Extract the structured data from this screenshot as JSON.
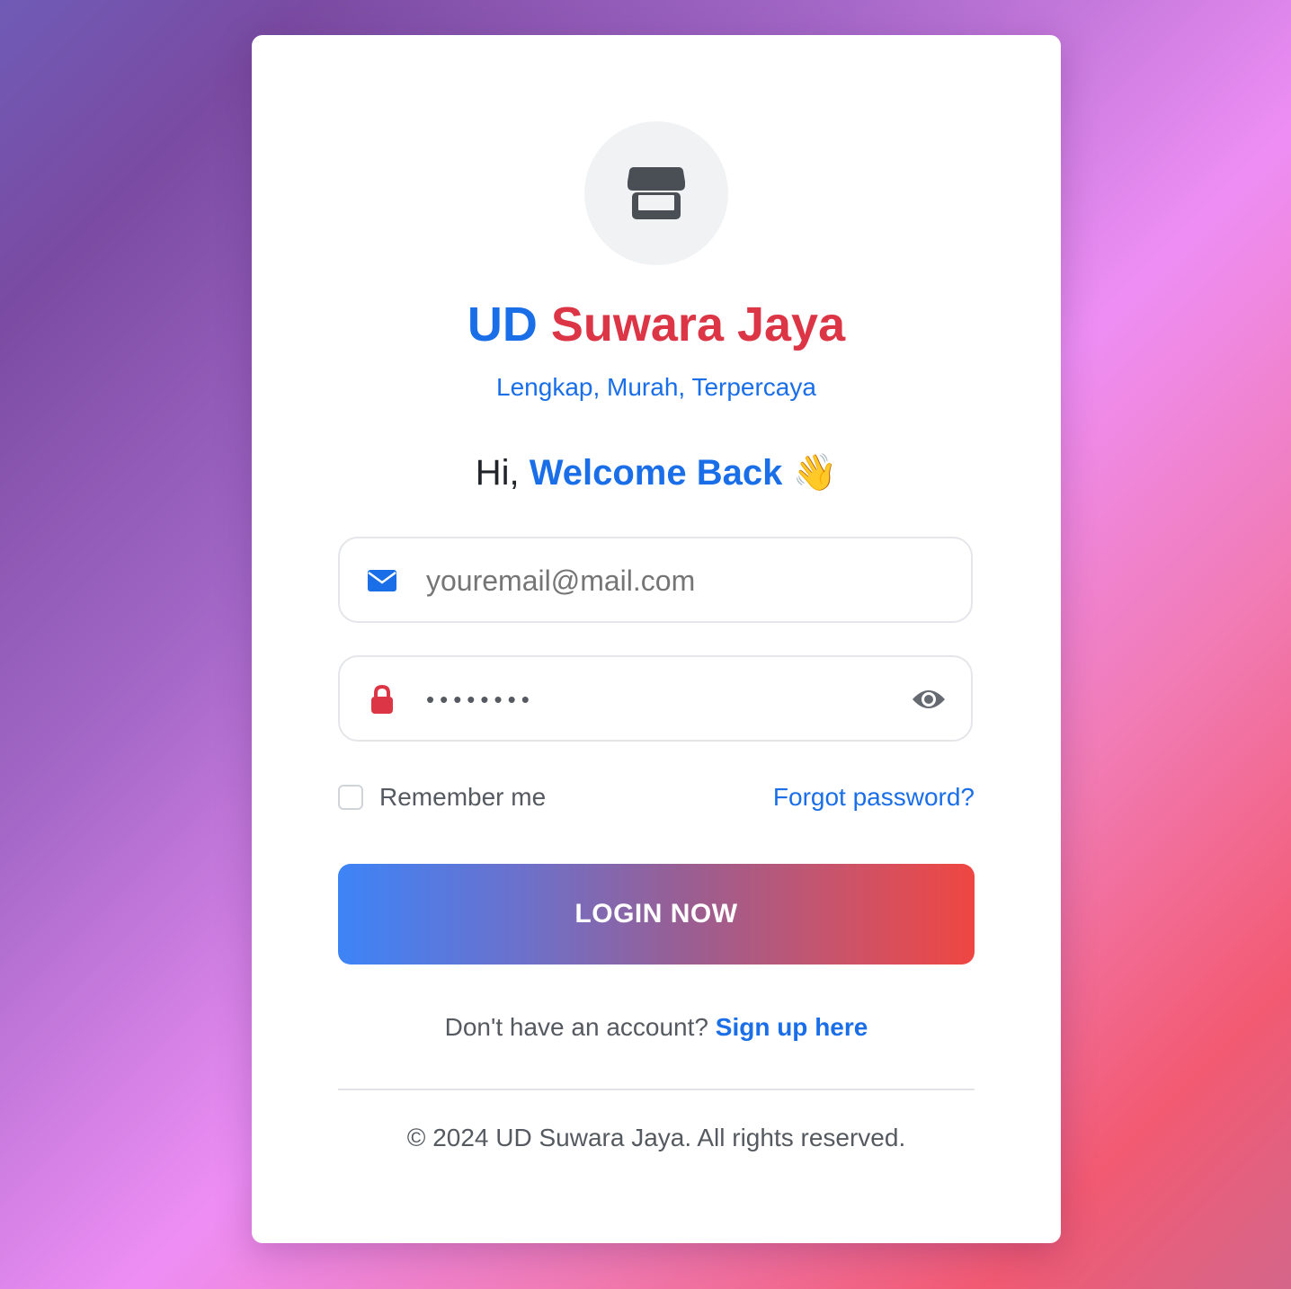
{
  "brand": {
    "prefix": "UD",
    "name": "Suwara Jaya",
    "tagline": "Lengkap, Murah, Terpercaya",
    "logo_icon": "store-icon"
  },
  "welcome": {
    "greeting": "Hi,",
    "highlight": "Welcome Back",
    "emoji": "👋"
  },
  "form": {
    "email": {
      "icon": "envelope-icon",
      "placeholder": "youremail@mail.com",
      "value": ""
    },
    "password": {
      "icon": "lock-icon",
      "value": "••••••••",
      "toggle_icon": "eye-icon"
    },
    "remember_label": "Remember me",
    "remember_checked": false,
    "forgot_label": "Forgot password?",
    "submit_label": "LOGIN NOW"
  },
  "signup": {
    "prompt": "Don't have an account?",
    "link": "Sign up here"
  },
  "footer": {
    "text": "© 2024 UD Suwara Jaya. All rights reserved."
  },
  "colors": {
    "primary": "#1a6ee8",
    "danger": "#dc3545",
    "button_gradient_start": "#3d84f7",
    "button_gradient_end": "#ef4641"
  }
}
